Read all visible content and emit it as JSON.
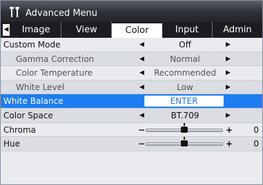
{
  "window": {
    "title": "Advanced Menu",
    "icon": "wrench-screwdriver-icon"
  },
  "tabs": {
    "left_arrow": "◀",
    "items": [
      {
        "label": "Image",
        "active": false
      },
      {
        "label": "View",
        "active": false
      },
      {
        "label": "Color",
        "active": true
      },
      {
        "label": "Input",
        "active": false
      },
      {
        "label": "Admin",
        "active": false
      }
    ]
  },
  "rows": {
    "custom_mode": {
      "label": "Custom Mode",
      "value": "Off"
    },
    "gamma": {
      "label": "Gamma Correction",
      "value": "Normal"
    },
    "color_temp": {
      "label": "Color Temperature",
      "value": "Recommended"
    },
    "white_level": {
      "label": "White Level",
      "value": "Low"
    },
    "white_balance": {
      "label": "White Balance",
      "button": "ENTER"
    },
    "color_space": {
      "label": "Color Space",
      "value": "BT.709"
    },
    "chroma": {
      "label": "Chroma",
      "minus": "−",
      "plus": "+",
      "value": "0",
      "level": 0.5
    },
    "hue": {
      "label": "Hue",
      "minus": "−",
      "plus": "+",
      "value": "0",
      "level": 0.5
    }
  },
  "arrows": {
    "left": "◀",
    "right": "▶"
  },
  "colors": {
    "selection": "#1e7df0",
    "titlebar": "#2d3036"
  }
}
